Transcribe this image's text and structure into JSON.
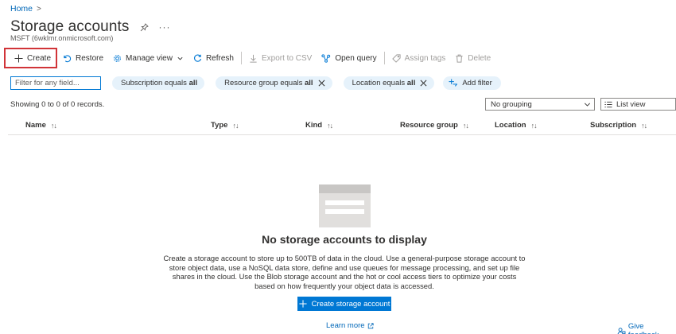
{
  "breadcrumb": {
    "home": "Home",
    "separator": ">"
  },
  "page": {
    "title": "Storage accounts",
    "subtitle": "MSFT (6wklmr.onmicrosoft.com)",
    "more": "···"
  },
  "toolbar": {
    "create": "Create",
    "restore": "Restore",
    "manage_view": "Manage view",
    "refresh": "Refresh",
    "export_csv": "Export to CSV",
    "open_query": "Open query",
    "assign_tags": "Assign tags",
    "delete": "Delete"
  },
  "filters": {
    "placeholder": "Filter for any field...",
    "subscription": {
      "prefix": "Subscription equals",
      "value": "all"
    },
    "resource_group": {
      "prefix": "Resource group equals",
      "value": "all"
    },
    "location": {
      "prefix": "Location equals",
      "value": "all"
    },
    "add_filter": "Add filter"
  },
  "status": {
    "showing": "Showing 0 to 0 of 0 records."
  },
  "view": {
    "grouping": "No grouping",
    "list_view": "List view"
  },
  "columns": {
    "name": "Name",
    "type": "Type",
    "kind": "Kind",
    "resource_group": "Resource group",
    "location": "Location",
    "subscription": "Subscription",
    "sort_up": "↑↓",
    "sort_both": "↑↓"
  },
  "empty_state": {
    "title": "No storage accounts to display",
    "description": "Create a storage account to store up to 500TB of data in the cloud. Use a general-purpose storage account to store object data, use a NoSQL data store, define and use queues for message processing, and set up file shares in the cloud. Use the Blob storage account and the hot or cool access tiers to optimize your costs based on how frequently your object data is accessed.",
    "button": "Create storage account",
    "learn_more": "Learn more"
  },
  "feedback": "Give feedback",
  "colors": {
    "accent": "#0078d4",
    "link": "#0067b8",
    "highlight_border": "#d13438",
    "pill_bg": "#e6f2fb"
  }
}
